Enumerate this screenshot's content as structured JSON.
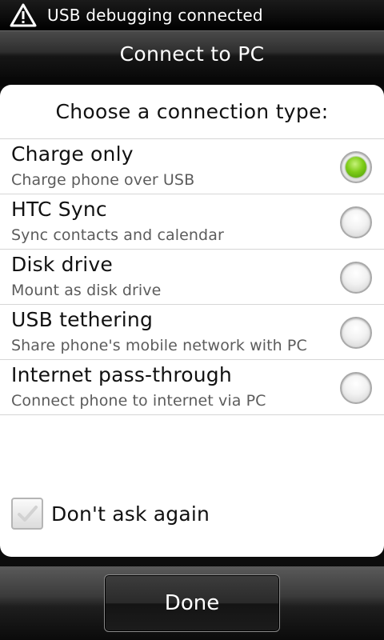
{
  "status_bar": {
    "icon": "usb-debug-warning-icon",
    "text": "USB debugging connected"
  },
  "title_bar": {
    "title": "Connect to PC"
  },
  "dialog": {
    "heading": "Choose a connection type:",
    "options": [
      {
        "title": "Charge only",
        "subtitle": "Charge phone over USB",
        "selected": true
      },
      {
        "title": "HTC Sync",
        "subtitle": "Sync contacts and calendar",
        "selected": false
      },
      {
        "title": "Disk drive",
        "subtitle": "Mount as disk drive",
        "selected": false
      },
      {
        "title": "USB tethering",
        "subtitle": "Share phone's mobile network with PC",
        "selected": false
      },
      {
        "title": "Internet pass-through",
        "subtitle": "Connect phone to internet via PC",
        "selected": false
      }
    ],
    "dont_ask": {
      "label": "Don't ask again",
      "checked": false
    }
  },
  "footer": {
    "done_label": "Done"
  },
  "colors": {
    "selected_radio": "#7fcd19",
    "panel_background": "#ffffff"
  }
}
